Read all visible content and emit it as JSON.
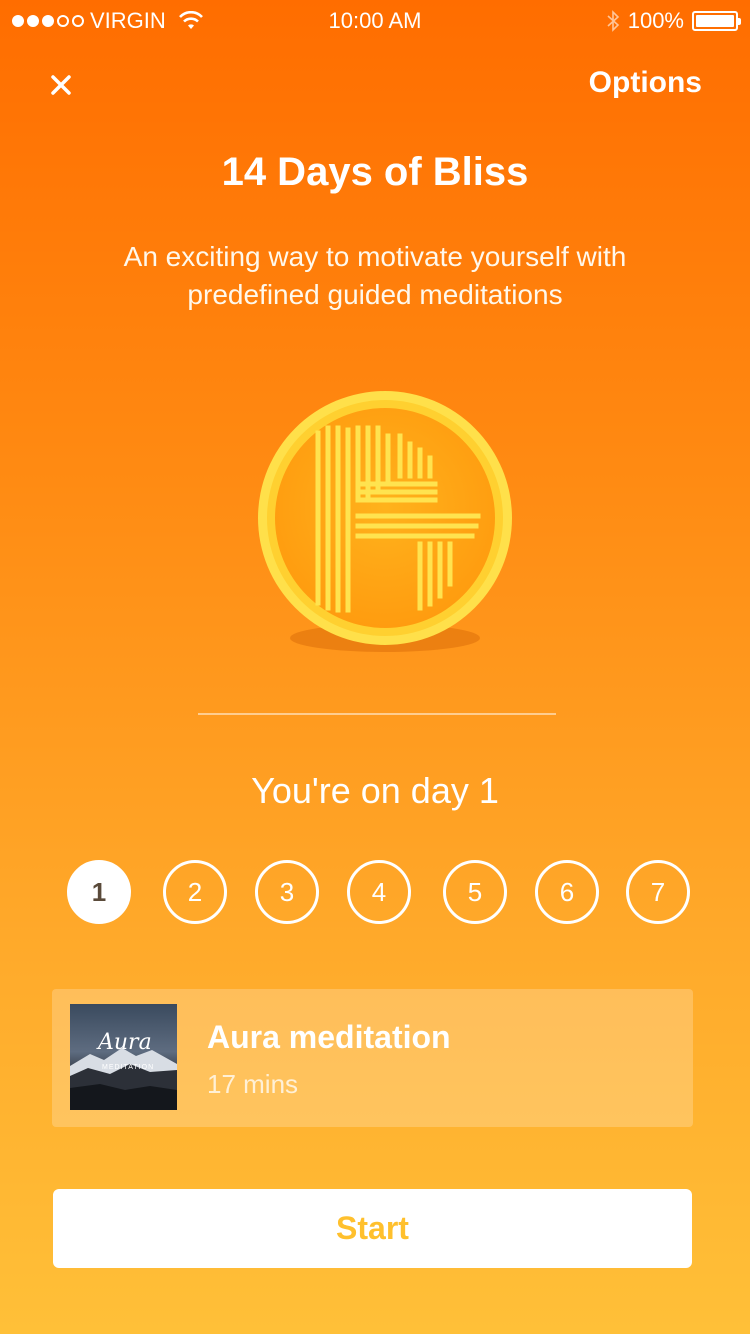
{
  "status_bar": {
    "carrier": "VIRGIN",
    "time": "10:00 AM",
    "battery": "100%"
  },
  "header": {
    "options_label": "Options"
  },
  "program": {
    "title": "14 Days of Bliss",
    "description": "An exciting way to motivate yourself with predefined guided meditations"
  },
  "progress": {
    "heading": "You're on day 1",
    "current_day": 1,
    "days": [
      "1",
      "2",
      "3",
      "4",
      "5",
      "6",
      "7"
    ]
  },
  "session": {
    "thumbnail_title": "Aura",
    "thumbnail_subtitle": "MEDITATION",
    "name": "Aura meditation",
    "duration": "17 mins"
  },
  "actions": {
    "start_label": "Start"
  },
  "colors": {
    "background_top": "#ff6d00",
    "background_bottom": "#ffc038",
    "start_text": "#ffc02d",
    "badge_gold": "#ffd83a"
  }
}
